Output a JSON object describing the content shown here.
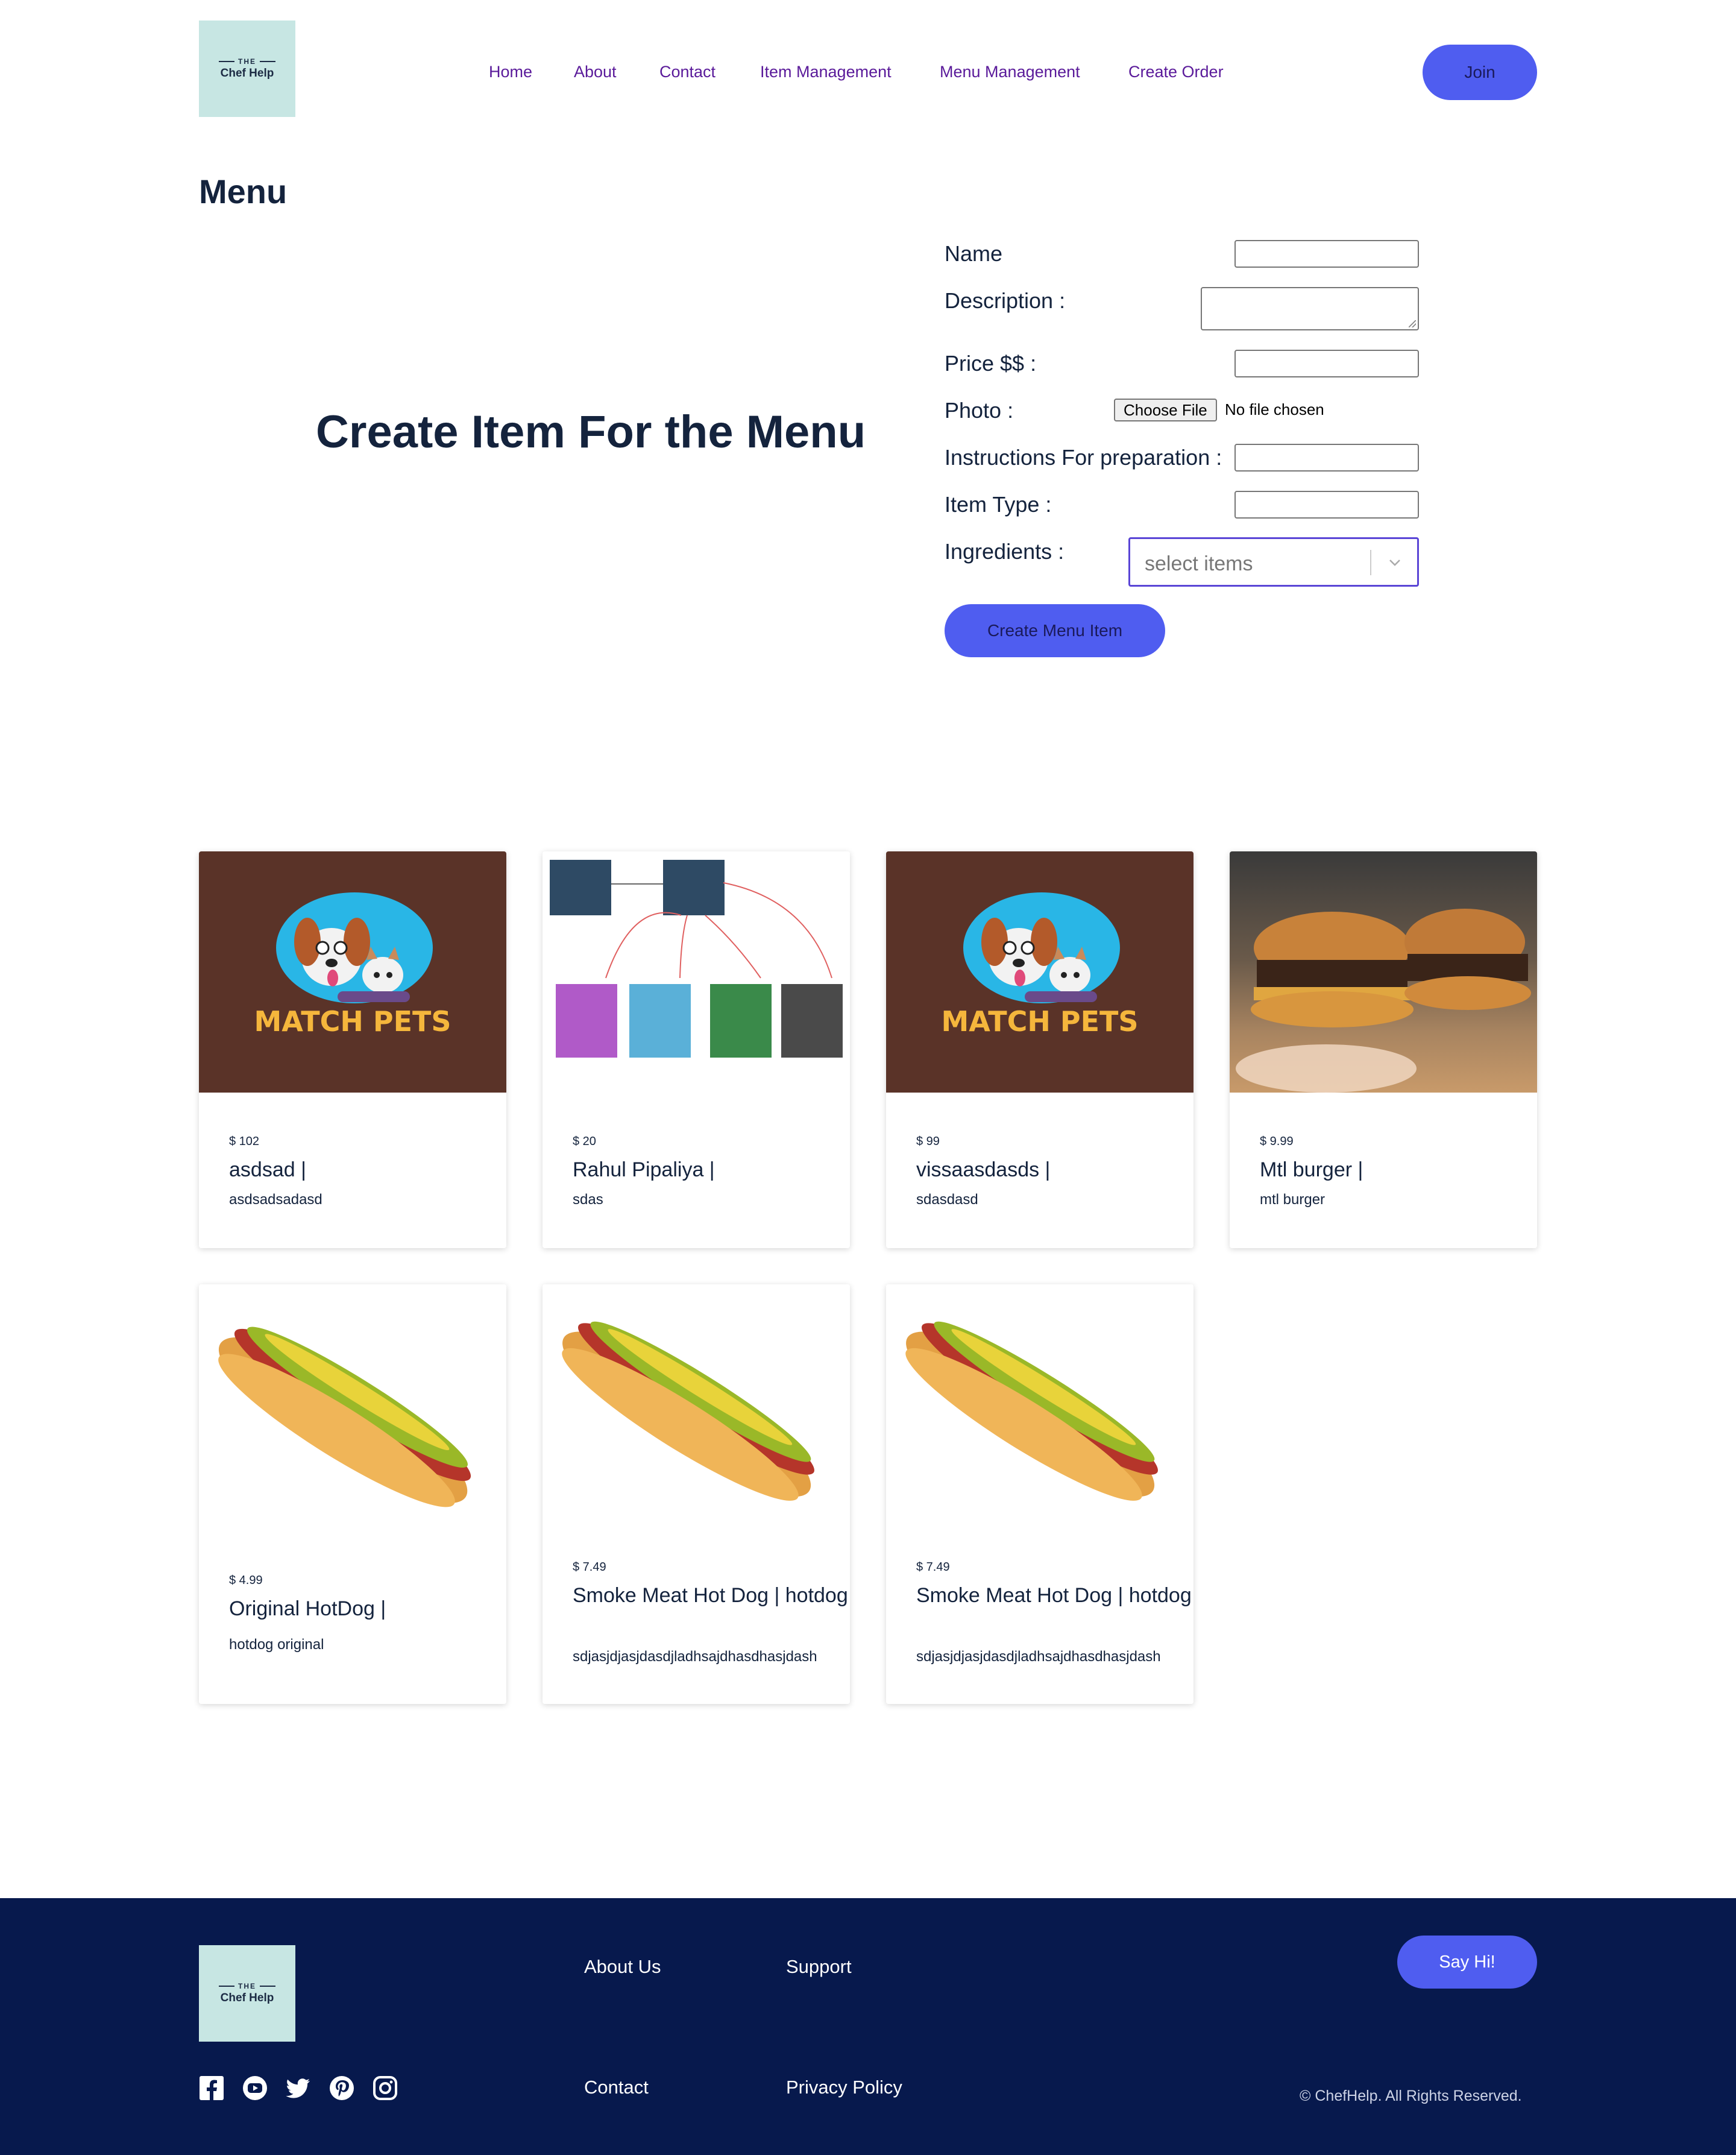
{
  "header": {
    "logo": {
      "top_text": "THE",
      "brand": "Chef Help"
    },
    "nav": [
      {
        "label": "Home"
      },
      {
        "label": "About"
      },
      {
        "label": "Contact"
      },
      {
        "label": "Item Management"
      },
      {
        "label": "Menu Management"
      },
      {
        "label": "Create Order"
      }
    ],
    "join_label": "Join"
  },
  "menu": {
    "title": "Menu",
    "hero_title": "Create Item For the Menu",
    "form": {
      "name_label": "Name",
      "description_label": "Description :",
      "price_label": "Price $$ :",
      "photo_label": "Photo :",
      "choose_file_label": "Choose File",
      "no_file_text": "No file chosen",
      "instructions_label": "Instructions For preparation :",
      "item_type_label": "Item Type :",
      "ingredients_label": "Ingredients :",
      "ingredients_placeholder": "select items",
      "submit_label": "Create Menu Item"
    }
  },
  "items": [
    {
      "price": "$ 102",
      "name": "asdsad |",
      "desc": "asdsadsadasd",
      "image": "match-pets-logo"
    },
    {
      "price": "$ 20",
      "name": "Rahul Pipaliya |",
      "desc": "sdas",
      "image": "uml-diagram"
    },
    {
      "price": "$ 99",
      "name": "vissaasdasds |",
      "desc": "sdasdasd",
      "image": "match-pets-logo"
    },
    {
      "price": "$ 9.99",
      "name": "Mtl burger |",
      "desc": "mtl burger",
      "image": "burger-photo"
    },
    {
      "price": "$ 4.99",
      "name": "Original HotDog |",
      "desc": "hotdog original",
      "image": "hotdog-photo"
    },
    {
      "price": "$ 7.49",
      "name": "Smoke Meat Hot Dog | hotdog",
      "desc": "sdjasjdjasjdasdjladhsajdhasdhasjdash",
      "image": "hotdog-photo"
    },
    {
      "price": "$ 7.49",
      "name": "Smoke Meat Hot Dog | hotdog",
      "desc": "sdjasjdjasjdasdjladhsajdhasdhasjdash",
      "image": "hotdog-photo"
    }
  ],
  "pets_logo_text": "MATCH PETS",
  "footer": {
    "logo": {
      "top_text": "THE",
      "brand": "Chef Help"
    },
    "links": [
      {
        "label": "About Us"
      },
      {
        "label": "Support"
      },
      {
        "label": "Contact"
      },
      {
        "label": "Privacy Policy"
      }
    ],
    "say_hi_label": "Say Hi!",
    "copyright": "© ChefHelp. All Rights Reserved.",
    "social_icons": [
      "facebook-icon",
      "youtube-icon",
      "twitter-icon",
      "pinterest-icon",
      "instagram-icon"
    ]
  },
  "colors": {
    "accent": "#4f5df0",
    "nav_link": "#5a1a9a",
    "heading": "#14233d",
    "footer_bg": "#07194d",
    "logo_bg": "#c7e6e3",
    "select_border": "#5a45d6"
  }
}
